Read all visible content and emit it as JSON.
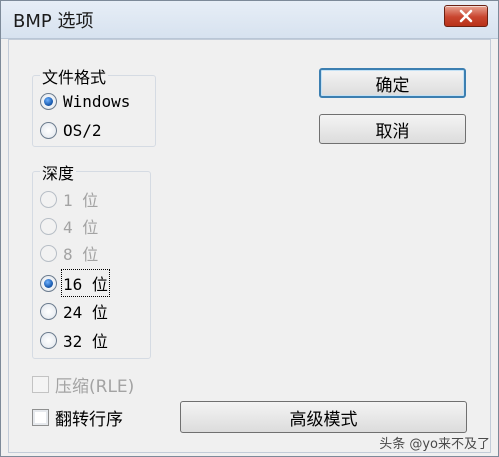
{
  "window": {
    "title": "BMP 选项"
  },
  "format_group": {
    "label": "文件格式",
    "options": [
      {
        "label": "Windows",
        "checked": true
      },
      {
        "label": "OS/2",
        "checked": false
      }
    ]
  },
  "depth_group": {
    "label": "深度",
    "options": [
      {
        "label": "1 位",
        "checked": false,
        "disabled": true
      },
      {
        "label": "4 位",
        "checked": false,
        "disabled": true
      },
      {
        "label": "8 位",
        "checked": false,
        "disabled": true
      },
      {
        "label": "16 位",
        "checked": true,
        "disabled": false
      },
      {
        "label": "24 位",
        "checked": false,
        "disabled": false
      },
      {
        "label": "32 位",
        "checked": false,
        "disabled": false
      }
    ]
  },
  "buttons": {
    "ok": "确定",
    "cancel": "取消",
    "advanced": "高级模式"
  },
  "checkboxes": {
    "compress": {
      "label": "压缩(RLE)",
      "checked": false,
      "disabled": true
    },
    "flip": {
      "label": "翻转行序",
      "checked": false,
      "disabled": false
    }
  },
  "watermark": {
    "text": "头条 @yo来不及了"
  }
}
